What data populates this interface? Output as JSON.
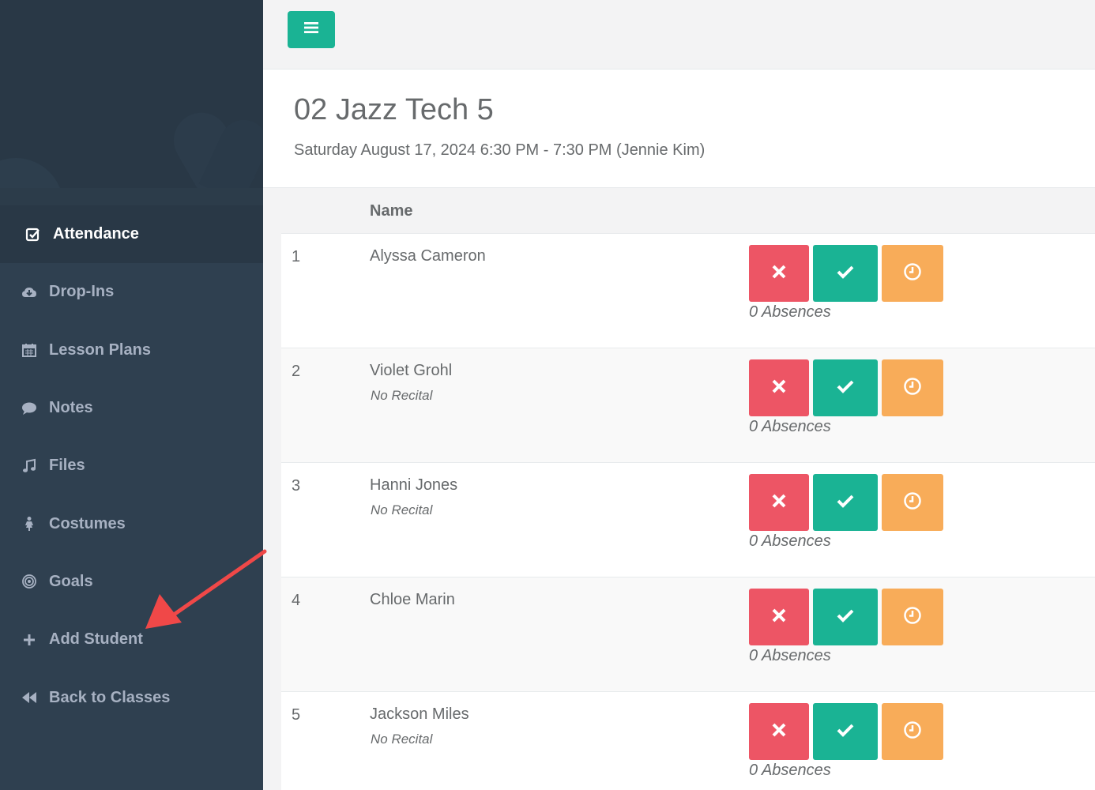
{
  "sidebar": {
    "items": [
      {
        "label": "Attendance",
        "icon": "check-square-icon",
        "active": true
      },
      {
        "label": "Drop-Ins",
        "icon": "cloud-download-icon"
      },
      {
        "label": "Lesson Plans",
        "icon": "calendar-icon"
      },
      {
        "label": "Notes",
        "icon": "comment-icon"
      },
      {
        "label": "Files",
        "icon": "music-icon"
      },
      {
        "label": "Costumes",
        "icon": "female-icon"
      },
      {
        "label": "Goals",
        "icon": "bullseye-icon"
      },
      {
        "label": "Add Student",
        "icon": "plus-icon"
      },
      {
        "label": "Back to Classes",
        "icon": "backward-icon"
      }
    ]
  },
  "header": {
    "menu_icon": "bars-icon"
  },
  "page": {
    "title": "02 Jazz Tech 5",
    "subtitle": "Saturday August 17, 2024 6:30 PM - 7:30 PM (Jennie Kim)"
  },
  "table": {
    "column_name": "Name",
    "rows": [
      {
        "num": "1",
        "name": "Alyssa Cameron",
        "note": "",
        "absences": "0 Absences"
      },
      {
        "num": "2",
        "name": "Violet Grohl",
        "note": "No Recital",
        "absences": "0 Absences"
      },
      {
        "num": "3",
        "name": "Hanni Jones",
        "note": "No Recital",
        "absences": "0 Absences"
      },
      {
        "num": "4",
        "name": "Chloe Marin",
        "note": "",
        "absences": "0 Absences"
      },
      {
        "num": "5",
        "name": "Jackson Miles",
        "note": "No Recital",
        "absences": "0 Absences"
      }
    ]
  },
  "colors": {
    "sidebar_bg": "#2f4050",
    "accent_green": "#1ab394",
    "absent_red": "#ed5565",
    "late_orange": "#f8ac59",
    "annotation_arrow": "#f04848"
  }
}
